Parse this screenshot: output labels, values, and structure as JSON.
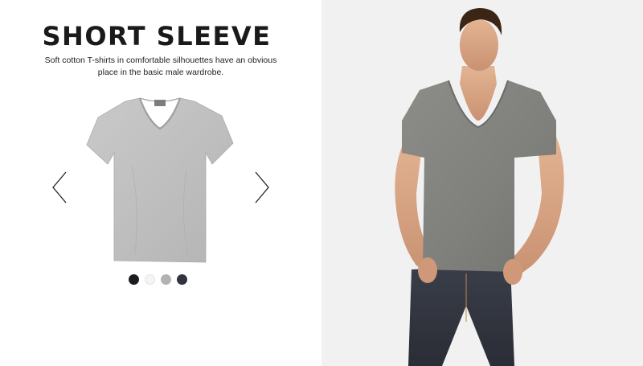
{
  "header": {
    "title": "SHORT SLEEVE",
    "description": "Soft cotton T-shirts in comfortable silhouettes have an obvious place in the basic male wardrobe."
  },
  "carousel": {
    "prev_icon": "chevron-left-icon",
    "next_icon": "chevron-right-icon",
    "product_image": "grey-v-neck-tshirt",
    "product_label": "H&M"
  },
  "swatches": [
    {
      "name": "black",
      "color": "#1c1c20"
    },
    {
      "name": "white",
      "color": "#f4f4f4"
    },
    {
      "name": "grey",
      "color": "#b3b3b3"
    },
    {
      "name": "navy",
      "color": "#30343f"
    }
  ],
  "model_photo": {
    "image": "model-wearing-grey-v-neck"
  }
}
